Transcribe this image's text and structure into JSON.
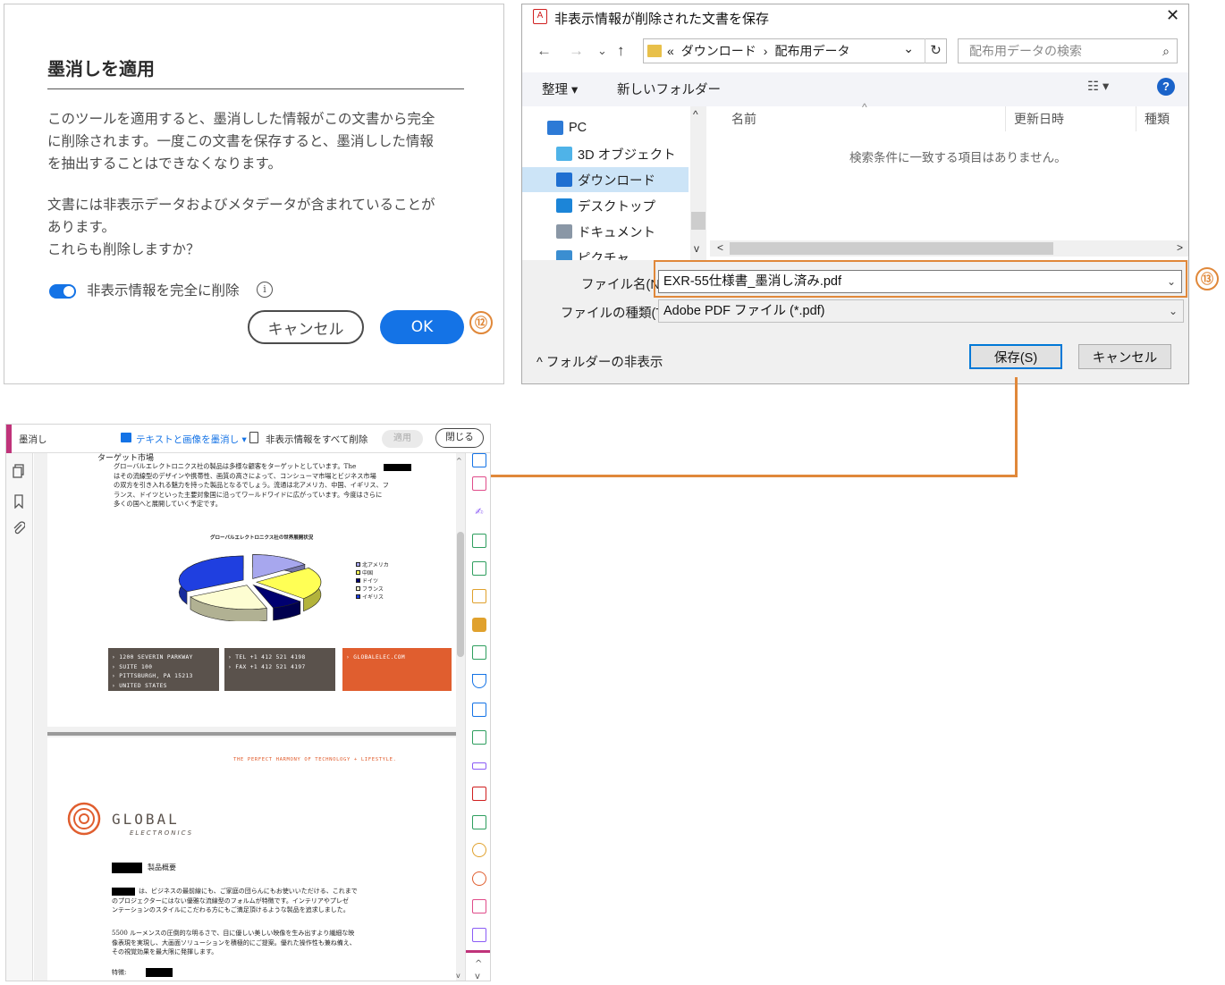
{
  "redact_dialog": {
    "title": "墨消しを適用",
    "paragraph1": "このツールを適用すると、墨消しした情報がこの文書から完全\nに削除されます。一度この文書を保存すると、墨消しした情報\nを抽出することはできなくなります。",
    "paragraph2": "文書には非表示データおよびメタデータが含まれていることが\nあります。\nこれらも削除しますか？",
    "toggle_label": "非表示情報を完全に削除",
    "toggle_on": true,
    "info_glyph": "i",
    "cancel_label": "キャンセル",
    "ok_label": "OK",
    "step_badge": "⑫"
  },
  "save_dialog": {
    "title": "非表示情報が削除された文書を保存",
    "close_glyph": "✕",
    "nav_back": "←",
    "nav_forward": "→",
    "nav_recent": "⌄",
    "nav_up": "↑",
    "address_prefix": "«",
    "breadcrumb_1": "ダウンロード",
    "breadcrumb_sep": "›",
    "breadcrumb_2": "配布用データ",
    "address_chevron": "⌄",
    "refresh_glyph": "↻",
    "search_placeholder": "配布用データの検索",
    "search_glyph": "⌕",
    "organize_label": "整理 ▾",
    "new_folder_label": "新しいフォルダー",
    "view_glyph": "☷ ▾",
    "help_glyph": "?",
    "tree": [
      {
        "label": "PC",
        "color": "#2d7ad6",
        "selected": false,
        "indent": false
      },
      {
        "label": "3D オブジェクト",
        "color": "#4fb3e8",
        "selected": false,
        "indent": true
      },
      {
        "label": "ダウンロード",
        "color": "#1f6fd1",
        "selected": true,
        "indent": true
      },
      {
        "label": "デスクトップ",
        "color": "#1c85d8",
        "selected": false,
        "indent": true
      },
      {
        "label": "ドキュメント",
        "color": "#8a97a6",
        "selected": false,
        "indent": true
      },
      {
        "label": "ピクチャ",
        "color": "#3b8ed1",
        "selected": false,
        "indent": true
      }
    ],
    "col_name": "名前",
    "col_sort_glyph": "^",
    "col_modified": "更新日時",
    "col_type": "種類",
    "empty_message": "検索条件に一致する項目はありません。",
    "scroll_up": "^",
    "scroll_down": "v",
    "scroll_left": "<",
    "scroll_right": ">",
    "filename_label": "ファイル名(N):",
    "filename_value": "EXR-55仕様書_墨消し済み.pdf",
    "filetype_label": "ファイルの種類(T):",
    "filetype_value": "Adobe PDF ファイル (*.pdf)",
    "field_chevron": "⌄",
    "hide_folders_label": "^ フォルダーの非表示",
    "save_label": "保存(S)",
    "cancel_label": "キャンセル",
    "step_badge": "⑬"
  },
  "viewer": {
    "tool_name": "墨消し",
    "redact_tool": "テキストと画像を墨消し ▾",
    "remove_hidden": "非表示情報をすべて削除",
    "apply_label": "適用",
    "close_label": "閉じる",
    "left_icons": [
      "pages-icon",
      "bookmark-icon",
      "attachment-icon"
    ],
    "page1": {
      "heading": "ターゲット市場",
      "body": "グローバルエレクトロニクス社の製品は多様な顧客をターゲットとしています。The\nはその流線型のデザインや携帯性、画質の高さによって、コンシューマ市場とビジネス市場\nの双方を引き入れる魅力を持った製品となるでしょう。流通は北アメリカ、中国、イギリス、フ\nランス、ドイツといった主要対象国に沿ってワールドワイドに広がっています。今度はさらに\n多くの国へと展開していく予定です。",
      "chart_title": "グローバルエレクトロニクス社の世界展開状況",
      "address_1": "› 1200 SEVERIN PARKWAY\n› SUITE 100\n› PITTSBURGH, PA 15213\n› UNITED STATES",
      "address_2": "› TEL +1 412 521 4198\n› FAX +1 412 521 4197",
      "address_3": "› GLOBALELEC.COM"
    },
    "page2": {
      "tagline": "THE PERFECT HARMONY OF TECHNOLOGY + LIFESTYLE.",
      "logo_main": "GLOBAL",
      "logo_sub": "ELECTRONICS",
      "section_title": "製品概要",
      "para1": "は、ビジネスの最前線にも、ご家庭の団らんにもお使いいただける、これまで\nのプロジェクターにはない優雅な流線型のフォルムが特徴です。インテリアやプレゼ\nンテーションのスタイルにこだわる方にもご満足頂けるような製品を追求しました。",
      "para2": "5500 ルーメンスの圧倒的な明るさで、目に優しい美しい映像を生み出すより繊細な映\n像表現を実現し、大画面ソリューションを積極的にご提案。優れた操作性も兼ね備え、\nその視覚効果を最大限に発揮します。",
      "features_label": "特徴:"
    }
  },
  "chart_data": {
    "type": "pie",
    "title": "グローバルエレクトロニクス社の世界展開状況",
    "categories": [
      "北アメリカ",
      "中国",
      "ドイツ",
      "フランス",
      "イギリス"
    ],
    "values": [
      15,
      22,
      8,
      22,
      33
    ],
    "colors": [
      "#a7a7ee",
      "#ffff55",
      "#000070",
      "#fdfdd2",
      "#1f3fe0"
    ],
    "legend_position": "right"
  }
}
